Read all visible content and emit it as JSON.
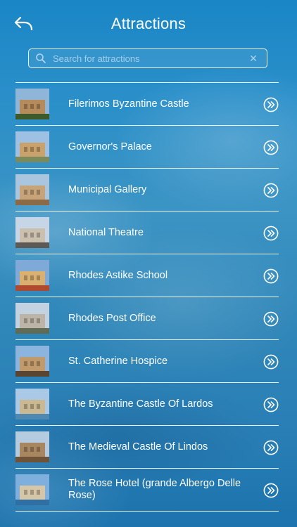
{
  "header": {
    "title": "Attractions",
    "back_icon": "back-arrow-icon"
  },
  "search": {
    "placeholder": "Search for attractions",
    "value": ""
  },
  "items": [
    {
      "label": "Filerimos Byzantine Castle",
      "thumb_colors": [
        "#8fb6d9",
        "#b58b5c",
        "#3d5a2b"
      ]
    },
    {
      "label": "Governor's Palace",
      "thumb_colors": [
        "#9ec1e3",
        "#c9a16a",
        "#7a8a5a"
      ]
    },
    {
      "label": "Municipal Gallery",
      "thumb_colors": [
        "#aac6df",
        "#c7a37a",
        "#8c6a45"
      ]
    },
    {
      "label": "National Theatre",
      "thumb_colors": [
        "#c7d6e6",
        "#cbbfae",
        "#5d5a55"
      ]
    },
    {
      "label": "Rhodes Astike School",
      "thumb_colors": [
        "#7fa9d6",
        "#d9b070",
        "#b04a2e"
      ]
    },
    {
      "label": "Rhodes Post Office",
      "thumb_colors": [
        "#c2d2e0",
        "#bcb4a6",
        "#5f6b55"
      ]
    },
    {
      "label": "St. Catherine Hospice",
      "thumb_colors": [
        "#8bb4de",
        "#c09a6b",
        "#5a4533"
      ]
    },
    {
      "label": "The Byzantine Castle Of Lardos",
      "thumb_colors": [
        "#a9c9e6",
        "#c9b892",
        "#4f88b0"
      ]
    },
    {
      "label": "The Medieval Castle Of Lindos",
      "thumb_colors": [
        "#b5cbe0",
        "#a88660",
        "#6e5338"
      ]
    },
    {
      "label": "The Rose Hotel (grande Albergo Delle Rose)",
      "thumb_colors": [
        "#7fb0dd",
        "#d6c6a8",
        "#2f6fa3"
      ]
    }
  ]
}
